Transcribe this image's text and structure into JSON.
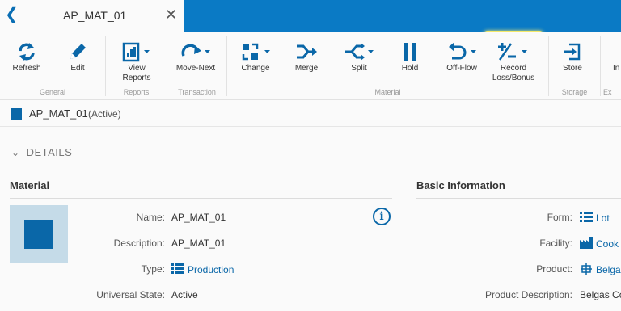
{
  "tab": {
    "title": "AP_MAT_01",
    "back_icon": "chevron-left-icon",
    "close_icon": "close-icon"
  },
  "ribbon": {
    "buttons": [
      {
        "label": "Refresh",
        "icon": "refresh-icon"
      },
      {
        "label": "Edit",
        "icon": "pencil-icon"
      },
      {
        "label": "View Reports",
        "label_line1": "View",
        "label_line2": "Reports",
        "icon": "report-icon"
      },
      {
        "label": "Move-Next",
        "icon": "redo-icon"
      },
      {
        "label": "Change",
        "icon": "change-icon"
      },
      {
        "label": "Merge",
        "icon": "merge-icon"
      },
      {
        "label": "Split",
        "icon": "split-icon"
      },
      {
        "label": "Hold",
        "icon": "pause-icon"
      },
      {
        "label": "Off-Flow",
        "icon": "undo-icon"
      },
      {
        "label": "Record Loss/Bonus",
        "label_line1": "Record",
        "label_line2": "Loss/Bonus",
        "icon": "plus-minus-icon"
      },
      {
        "label": "Store",
        "icon": "store-icon"
      },
      {
        "label": "In"
      }
    ],
    "groups": [
      "General",
      "Reports",
      "Transaction",
      "Material",
      "Storage",
      "Ex"
    ]
  },
  "status": {
    "name": "AP_MAT_01",
    "state": "(Active)"
  },
  "details_label": "DETAILS",
  "material": {
    "section_title": "Material",
    "fields": [
      {
        "label": "Name:",
        "value": "AP_MAT_01"
      },
      {
        "label": "Description:",
        "value": "AP_MAT_01"
      },
      {
        "label": "Type:",
        "value": "Production"
      },
      {
        "label": "Universal State:",
        "value": "Active"
      }
    ]
  },
  "basic": {
    "section_title": "Basic Information",
    "fields": [
      {
        "label": "Form:",
        "value": "Lot"
      },
      {
        "label": "Facility:",
        "value": "Cook"
      },
      {
        "label": "Product:",
        "value": "Belga"
      },
      {
        "label": "Product Description:",
        "value": "Belgas Co"
      }
    ]
  },
  "colors": {
    "accent": "#0a7ac5",
    "link": "#0a67a8",
    "highlight": "#f5e96a"
  }
}
